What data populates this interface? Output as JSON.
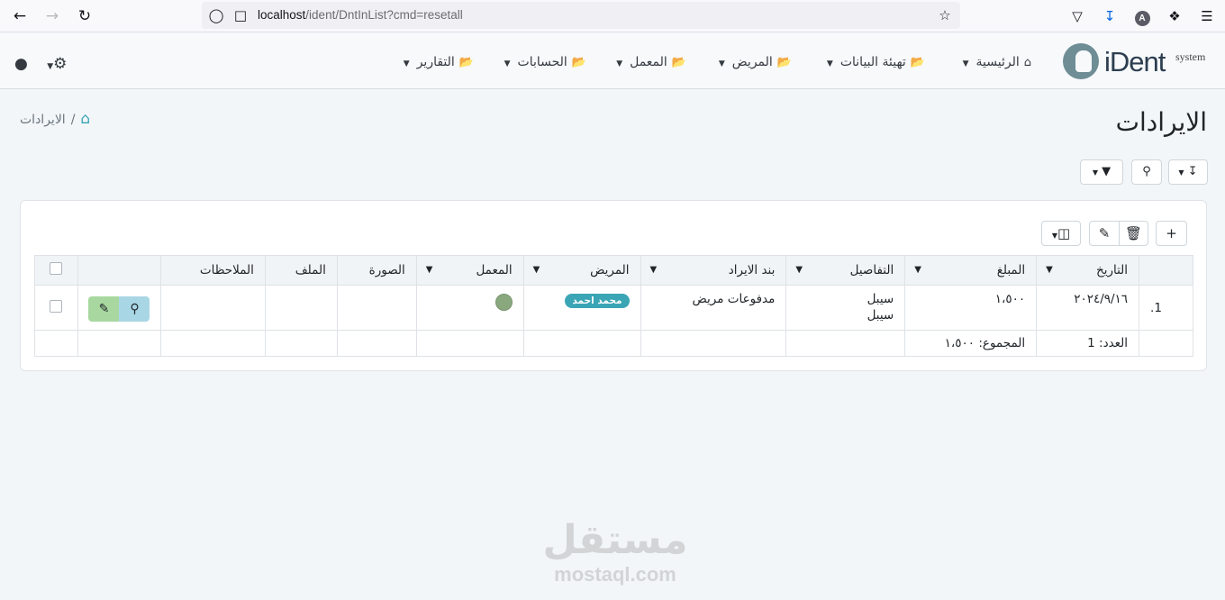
{
  "browser": {
    "url_host": "localhost",
    "url_path": "/ident/DntInList?cmd=resetall",
    "profile_initial": "A"
  },
  "app": {
    "logo_text": "iDent",
    "logo_sup": "system",
    "menu": [
      {
        "label": "الرئيسية"
      },
      {
        "label": "تهيئة البيانات"
      },
      {
        "label": "المريض"
      },
      {
        "label": "المعمل"
      },
      {
        "label": "الحسابات"
      },
      {
        "label": "التقارير"
      }
    ]
  },
  "page": {
    "title": "الايرادات",
    "breadcrumb_current": "الايرادات",
    "breadcrumb_sep": "/"
  },
  "table": {
    "headers": {
      "date": "التاريخ",
      "amount": "المبلغ",
      "details": "التفاصيل",
      "item": "بند الايراد",
      "patient": "المريض",
      "lab": "المعمل",
      "image": "الصورة",
      "file": "الملف",
      "notes": "الملاحظات"
    },
    "rows": [
      {
        "num": "1.",
        "date": "٢٠٢٤/٩/١٦",
        "amount": "١،٥٠٠",
        "details_line1": "سيبل",
        "details_line2": "سيبل",
        "item": "مدفوعات مريض",
        "patient": "محمد احمد"
      }
    ],
    "footer": {
      "count_label": "العدد:",
      "count_value": "1",
      "sum_label": "المجموع:",
      "sum_value": "١،٥٠٠"
    }
  },
  "watermark": {
    "ar": "مستقل",
    "en": "mostaql.com"
  },
  "colors": {
    "accent": "#3aa5b5",
    "edit_btn": "#a8d8a0",
    "view_btn": "#a9d6e5"
  }
}
